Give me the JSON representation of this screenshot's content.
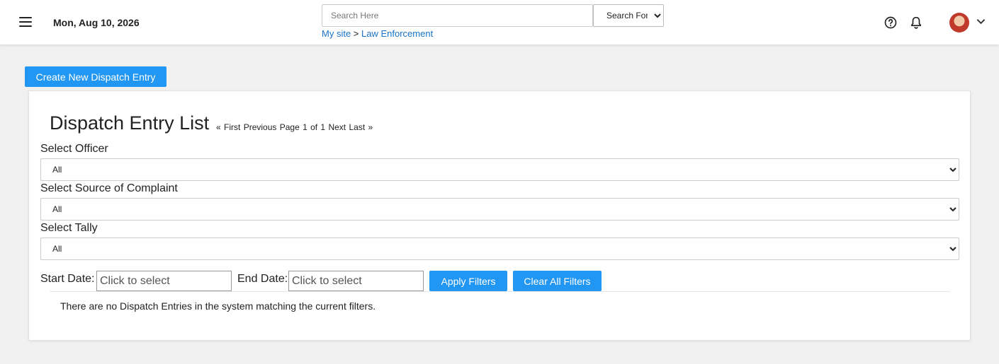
{
  "header": {
    "date": "Mon, Aug 10, 2026",
    "search_placeholder": "Search Here",
    "search_for_label": "Search For...",
    "breadcrumb": {
      "my_site": "My site",
      "separator": ">",
      "current": "Law Enforcement"
    },
    "icons": {
      "menu": "menu-icon",
      "help": "help-icon",
      "notifications": "bell-icon",
      "avatar": "avatar",
      "account_menu": "chevron-down-icon"
    }
  },
  "actions": {
    "create_label": "Create New Dispatch Entry"
  },
  "list": {
    "title": "Dispatch Entry List",
    "pager": {
      "first": "« First",
      "previous": "Previous",
      "page_info": "Page 1 of 1",
      "next": "Next",
      "last": "Last »"
    }
  },
  "filters": {
    "officer": {
      "label": "Select Officer",
      "value": "All"
    },
    "source": {
      "label": "Select Source of Complaint",
      "value": "All"
    },
    "tally": {
      "label": "Select Tally",
      "value": "All"
    },
    "start_date": {
      "label": "Start Date:",
      "placeholder": "Click to select"
    },
    "end_date": {
      "label": "End Date:",
      "placeholder": "Click to select"
    },
    "apply_label": "Apply Filters",
    "clear_label": "Clear All Filters"
  },
  "empty_message": "There are no Dispatch Entries in the system matching the current filters.",
  "colors": {
    "primary": "#2196f3",
    "link": "#1a73c9",
    "background": "#f1f1f1"
  }
}
